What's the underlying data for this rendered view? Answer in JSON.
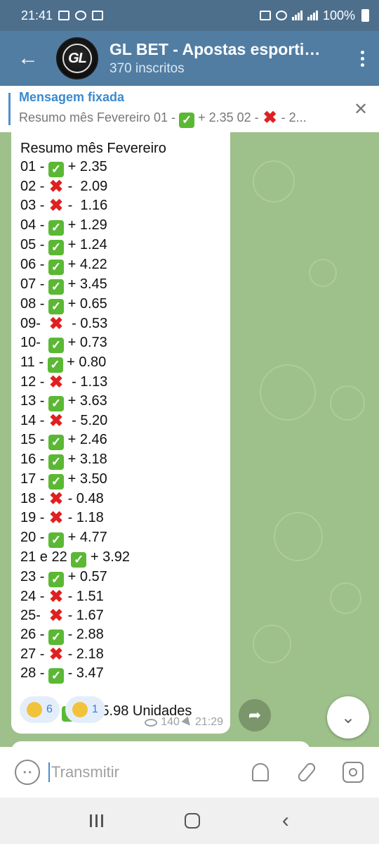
{
  "status_bar": {
    "time": "21:41",
    "battery": "100%"
  },
  "header": {
    "back_icon": "arrow-left-icon",
    "avatar_text": "GL",
    "title": "GL BET - Apostas esportivas",
    "subtitle": "370 inscritos",
    "menu_icon": "more-vertical-icon"
  },
  "pinned": {
    "title": "Mensagem fixada",
    "snippet": [
      {
        "t": "Resumo mês Fevereiro  01 - "
      },
      {
        "m": "check"
      },
      {
        "t": " + 2.35 02 - "
      },
      {
        "m": "cross"
      },
      {
        "t": " -  2..."
      }
    ]
  },
  "message": {
    "lines": [
      [
        {
          "t": "Resumo mês Fevereiro"
        }
      ],
      [
        {
          "t": "01 - "
        },
        {
          "m": "check"
        },
        {
          "t": " + 2.35"
        }
      ],
      [
        {
          "t": "02 - "
        },
        {
          "m": "cross"
        },
        {
          "t": " -  2.09"
        }
      ],
      [
        {
          "t": "03 - "
        },
        {
          "m": "cross"
        },
        {
          "t": " -  1.16"
        }
      ],
      [
        {
          "t": "04 - "
        },
        {
          "m": "check"
        },
        {
          "t": " + 1.29"
        }
      ],
      [
        {
          "t": "05 - "
        },
        {
          "m": "check"
        },
        {
          "t": " + 1.24"
        }
      ],
      [
        {
          "t": "06 - "
        },
        {
          "m": "check"
        },
        {
          "t": " + 4.22"
        }
      ],
      [
        {
          "t": "07 - "
        },
        {
          "m": "check"
        },
        {
          "t": " + 3.45"
        }
      ],
      [
        {
          "t": "08 - "
        },
        {
          "m": "check"
        },
        {
          "t": " + 0.65"
        }
      ],
      [
        {
          "t": "09-  "
        },
        {
          "m": "cross"
        },
        {
          "t": "  - 0.53"
        }
      ],
      [
        {
          "t": "10-  "
        },
        {
          "m": "check"
        },
        {
          "t": " + 0.73"
        }
      ],
      [
        {
          "t": "11 - "
        },
        {
          "m": "check"
        },
        {
          "t": " + 0.80"
        }
      ],
      [
        {
          "t": "12 - "
        },
        {
          "m": "cross"
        },
        {
          "t": "  - 1.13"
        }
      ],
      [
        {
          "t": "13 - "
        },
        {
          "m": "check"
        },
        {
          "t": " + 3.63"
        }
      ],
      [
        {
          "t": "14 - "
        },
        {
          "m": "cross"
        },
        {
          "t": "  - 5.20"
        }
      ],
      [
        {
          "t": "15 - "
        },
        {
          "m": "check"
        },
        {
          "t": " + 2.46"
        }
      ],
      [
        {
          "t": "16 - "
        },
        {
          "m": "check"
        },
        {
          "t": " + 3.18"
        }
      ],
      [
        {
          "t": "17 - "
        },
        {
          "m": "check"
        },
        {
          "t": " + 3.50"
        }
      ],
      [
        {
          "t": "18 - "
        },
        {
          "m": "cross"
        },
        {
          "t": " - 0.48"
        }
      ],
      [
        {
          "t": "19 - "
        },
        {
          "m": "cross"
        },
        {
          "t": " - 1.18"
        }
      ],
      [
        {
          "t": "20 - "
        },
        {
          "m": "check"
        },
        {
          "t": " + 4.77"
        }
      ],
      [
        {
          "t": "21 e 22 "
        },
        {
          "m": "check"
        },
        {
          "t": " + 3.92"
        }
      ],
      [
        {
          "t": "23 - "
        },
        {
          "m": "check"
        },
        {
          "t": " + 0.57"
        }
      ],
      [
        {
          "t": "24 - "
        },
        {
          "m": "cross"
        },
        {
          "t": " - 1.51"
        }
      ],
      [
        {
          "t": "25-  "
        },
        {
          "m": "cross"
        },
        {
          "t": " - 1.67"
        }
      ],
      [
        {
          "t": "26 - "
        },
        {
          "m": "check"
        },
        {
          "t": " - 2.88"
        }
      ],
      [
        {
          "t": "27 - "
        },
        {
          "m": "cross"
        },
        {
          "t": " - 2.18"
        }
      ],
      [
        {
          "t": "28 - "
        },
        {
          "m": "check"
        },
        {
          "t": " - 3.47"
        }
      ],
      [],
      [
        {
          "t": "Total= "
        },
        {
          "m": "check"
        },
        {
          "t": " + 25.98 Unidades"
        }
      ]
    ],
    "reactions": [
      {
        "icon": "clapping-hands-icon",
        "count": "6"
      },
      {
        "icon": "thumbs-up-icon",
        "count": "1"
      }
    ],
    "views": "140",
    "time": "21:29"
  },
  "input": {
    "placeholder": "Transmitir"
  },
  "colors": {
    "header": "#527da3",
    "check": "#5bb834",
    "cross": "#e02020",
    "link": "#3a8ad0"
  }
}
